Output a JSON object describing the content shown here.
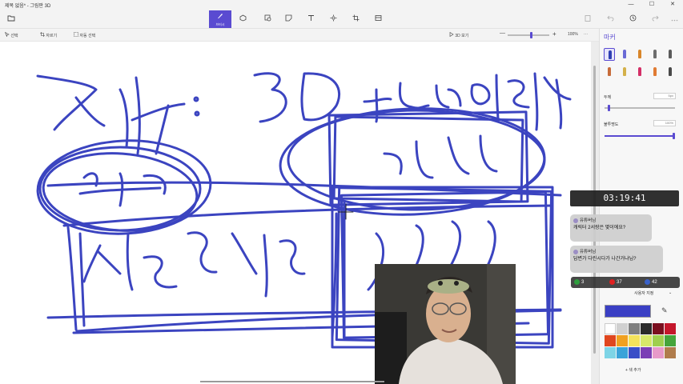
{
  "window": {
    "title": "제목 없음* - 그림판 3D",
    "controls": [
      "—",
      "☐",
      "✕"
    ]
  },
  "toolbar": {
    "menu_icon": "folder-icon",
    "active_label": "브러시",
    "tools": [
      "brush-icon",
      "shapes-3d-icon",
      "stickers-icon",
      "cube-icon",
      "text-icon",
      "effects-icon",
      "crop-icon",
      "mixed-reality-icon"
    ],
    "right_tools": [
      "paste-icon",
      "undo-icon",
      "history-icon",
      "redo-icon",
      "more-icon"
    ]
  },
  "subbar": {
    "select_label": "선택",
    "crop_label": "자르기",
    "magic_select_label": "자동 선택",
    "view3d_label": "3D 보기",
    "zoom_minus": "—",
    "zoom_plus": "+",
    "zoom_value": 0.58,
    "zoom_label": "100%",
    "more": "···"
  },
  "panel": {
    "title": "마커",
    "brush_colors": [
      "#2f3fb3",
      "#6b6bd6",
      "#d9862a",
      "#6e6e6e",
      "#5b5b5b",
      "#c76b3a",
      "#d4b14a",
      "#d42f67",
      "#e07b33",
      "#4a4a4a"
    ],
    "thickness_label": "두께",
    "thickness_value": "5px",
    "thickness_level": 0.05,
    "opacity_label": "불투명도",
    "opacity_value": "100%",
    "opacity_level": 1.0,
    "custom_color_label": "사용자 지정",
    "current_color": "#3a3fc4",
    "eyedropper": "eyedropper-icon",
    "palette": [
      "#ffffff",
      "#d0d0d0",
      "#7f7f7f",
      "#2a2a2a",
      "#7a0f1f",
      "#c4162b",
      "#e0461f",
      "#f0a020",
      "#f4e35c",
      "#d8e86a",
      "#9fcf4e",
      "#45a43b",
      "#7ed4e6",
      "#3aa3d9",
      "#3a4fc7",
      "#7b3fb5",
      "#e79ac9",
      "#b07c4c"
    ],
    "add_color_label": "+ 색 추가"
  },
  "overlay": {
    "time": "03:19:41",
    "chat": [
      {
        "user": "유튜버님",
        "message": "캐릭터 2서랑은 몇이에요?"
      },
      {
        "user": "유튜버님",
        "message": "답변가 다린시다가 나간거냐님?"
      }
    ],
    "stats": [
      {
        "icon": "kakao-icon",
        "color": "#2f9d3e",
        "value": "3"
      },
      {
        "icon": "youtube-icon",
        "color": "#e02020",
        "value": "37"
      },
      {
        "icon": "viewer-icon",
        "color": "#3a62c9",
        "value": "42"
      }
    ]
  },
  "canvas": {
    "ink_color": "#3b44c0"
  }
}
